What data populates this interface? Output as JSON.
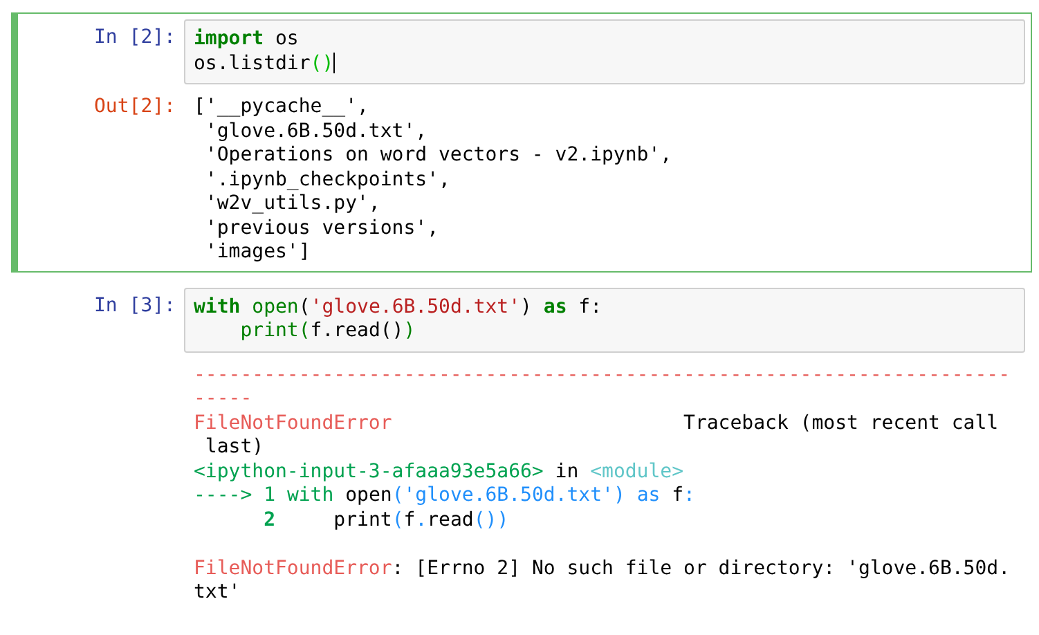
{
  "cells": [
    {
      "selected": true,
      "prompt": "In [2]:",
      "input": [
        [
          {
            "text": "import",
            "kind": "keyword"
          },
          {
            "text": " os",
            "kind": "plain"
          }
        ],
        [
          {
            "text": "os.listdir",
            "kind": "plain"
          },
          {
            "text": "()",
            "kind": "match"
          }
        ]
      ],
      "output": {
        "prompt": "Out[2]:",
        "lines": [
          [
            {
              "text": "['__pycache__',",
              "kind": "plain"
            }
          ],
          [
            {
              "text": " 'glove.6B.50d.txt',",
              "kind": "plain"
            }
          ],
          [
            {
              "text": " 'Operations on word vectors - v2.ipynb',",
              "kind": "plain"
            }
          ],
          [
            {
              "text": " '.ipynb_checkpoints',",
              "kind": "plain"
            }
          ],
          [
            {
              "text": " 'w2v_utils.py',",
              "kind": "plain"
            }
          ],
          [
            {
              "text": " 'previous versions',",
              "kind": "plain"
            }
          ],
          [
            {
              "text": " 'images']",
              "kind": "plain"
            }
          ]
        ]
      }
    },
    {
      "selected": false,
      "prompt": "In [3]:",
      "input": [
        [
          {
            "text": "with",
            "kind": "keyword"
          },
          {
            "text": " open",
            "kind": "builtin"
          },
          {
            "text": "(",
            "kind": "plain"
          },
          {
            "text": "'glove.6B.50d.txt'",
            "kind": "string"
          },
          {
            "text": ") ",
            "kind": "plain"
          },
          {
            "text": "as",
            "kind": "keyword"
          },
          {
            "text": " f:",
            "kind": "plain"
          }
        ],
        [
          {
            "text": "    print",
            "kind": "builtin"
          },
          {
            "text": "(",
            "kind": "builtin"
          },
          {
            "text": "f.read()",
            "kind": "plain"
          },
          {
            "text": ")",
            "kind": "builtin"
          }
        ]
      ],
      "output": {
        "lines": [
          [
            {
              "text": "----------------------------------------------------------------------",
              "kind": "ansi-red"
            }
          ],
          [
            {
              "text": "-----",
              "kind": "ansi-red"
            }
          ],
          [
            {
              "text": "FileNotFoundError",
              "kind": "ansi-red"
            },
            {
              "text": "                         Traceback (most recent call",
              "kind": "plain"
            }
          ],
          [
            {
              "text": " last)",
              "kind": "plain"
            }
          ],
          [
            {
              "text": "<ipython-input-3-afaaa93e5a66>",
              "kind": "ansi-green"
            },
            {
              "text": " in ",
              "kind": "plain"
            },
            {
              "text": "<module>",
              "kind": "ansi-cyan"
            }
          ],
          [
            {
              "text": "----> 1 ",
              "kind": "ansi-green"
            },
            {
              "text": "with",
              "kind": "ansi-green"
            },
            {
              "text": " open",
              "kind": "plain"
            },
            {
              "text": "(",
              "kind": "ansi-blue"
            },
            {
              "text": "'glove.6B.50d.txt'",
              "kind": "ansi-blue"
            },
            {
              "text": ") ",
              "kind": "ansi-blue"
            },
            {
              "text": "as",
              "kind": "ansi-blue"
            },
            {
              "text": " f",
              "kind": "plain"
            },
            {
              "text": ":",
              "kind": "ansi-blue"
            }
          ],
          [
            {
              "text": "      2",
              "kind": "ansi-bold-green"
            },
            {
              "text": "     print",
              "kind": "plain"
            },
            {
              "text": "(",
              "kind": "ansi-blue"
            },
            {
              "text": "f",
              "kind": "plain"
            },
            {
              "text": ".",
              "kind": "ansi-blue"
            },
            {
              "text": "read",
              "kind": "plain"
            },
            {
              "text": "())",
              "kind": "ansi-blue"
            }
          ],
          {
            "space_before": true,
            "segs": [
              {
                "text": "FileNotFoundError",
                "kind": "ansi-red"
              },
              {
                "text": ": [Errno 2] No such file or directory: 'glove.6B.50d.",
                "kind": "plain"
              }
            ]
          },
          [
            {
              "text": "txt'",
              "kind": "plain"
            }
          ]
        ]
      }
    }
  ]
}
